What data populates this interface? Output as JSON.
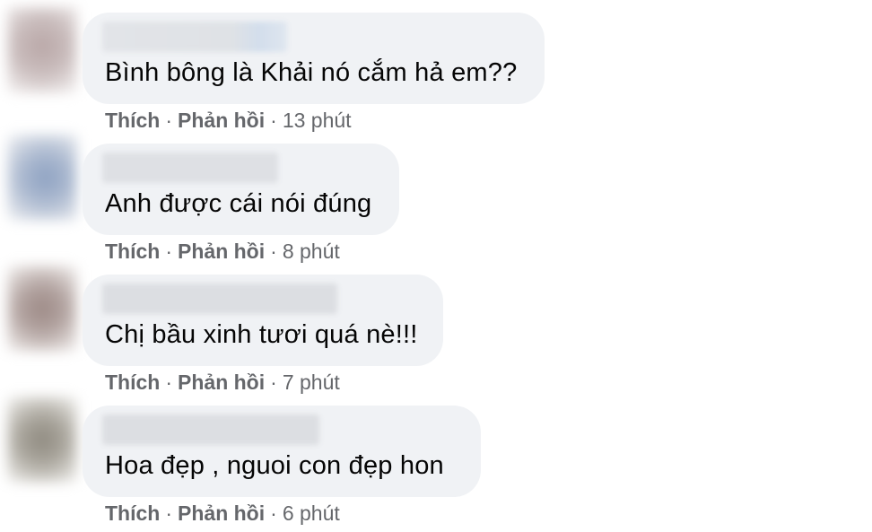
{
  "comments": [
    {
      "text": "Bình bông là Khải nó cắm hả em??",
      "like_label": "Thích",
      "reply_label": "Phản hồi",
      "time": "13 phút"
    },
    {
      "text": "Anh được cái nói đúng",
      "like_label": "Thích",
      "reply_label": "Phản hồi",
      "time": "8 phút"
    },
    {
      "text": "Chị bầu xinh tươi quá nè!!!",
      "like_label": "Thích",
      "reply_label": "Phản hồi",
      "time": "7 phút"
    },
    {
      "text": "Hoa đẹp , nguoi con đẹp hon",
      "like_label": "Thích",
      "reply_label": "Phản hồi",
      "time": "6 phút"
    }
  ],
  "separator": "·",
  "colors": {
    "bubble_background": "#f0f2f5",
    "comment_text": "#050505",
    "action_text": "#65676b"
  }
}
